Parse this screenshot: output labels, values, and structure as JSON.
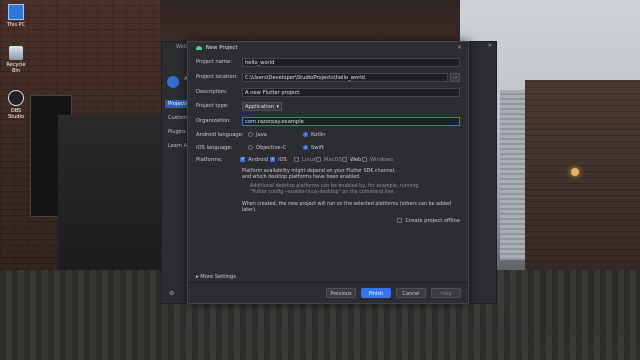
{
  "desktop": {
    "icons": [
      {
        "label": "This PC",
        "icon": "computer-icon"
      },
      {
        "label": "Recycle Bin",
        "icon": "recycle-bin-icon"
      },
      {
        "label": "OBS Studio",
        "icon": "obs-icon"
      }
    ]
  },
  "ide": {
    "title": "Welco",
    "side_label_1": "An",
    "menu": [
      {
        "label": "Projects",
        "active": true
      },
      {
        "label": "Customiz"
      },
      {
        "label": "Plugins"
      },
      {
        "label": "Learn An"
      }
    ]
  },
  "dialog": {
    "title": "New Project",
    "fields": {
      "project_name": {
        "label": "Project name:",
        "value": "hello_world"
      },
      "project_location": {
        "label": "Project location:",
        "value": "C:\\Users\\Developer\\StudioProjects\\hello_world",
        "browse": "..."
      },
      "description": {
        "label": "Description:",
        "value": "A new Flutter project."
      },
      "project_type": {
        "label": "Project type:",
        "value": "Application"
      },
      "organization": {
        "label": "Organization:",
        "value": "com.razorpay.example"
      }
    },
    "android_language": {
      "label": "Android language:",
      "options": [
        "Java",
        "Kotlin"
      ],
      "selected": "Kotlin"
    },
    "ios_language": {
      "label": "iOS language:",
      "options": [
        "Objective-C",
        "Swift"
      ],
      "selected": "Swift"
    },
    "platforms": {
      "label": "Platforms:",
      "items": [
        {
          "label": "Android",
          "checked": true,
          "enabled": true
        },
        {
          "label": "iOS",
          "checked": true,
          "enabled": true
        },
        {
          "label": "Linux",
          "checked": false,
          "enabled": false
        },
        {
          "label": "MacOS",
          "checked": false,
          "enabled": false
        },
        {
          "label": "Web",
          "checked": false,
          "enabled": true
        },
        {
          "label": "Windows",
          "checked": false,
          "enabled": false
        }
      ]
    },
    "notes": {
      "availability_1": "Platform availability might depend on your Flutter SDK channel,",
      "availability_2": "and which desktop platforms have been enabled.",
      "desktop_1": "Additional desktop platforms can be enabled by, for example, running",
      "desktop_2": "\"flutter config --enable-linux-desktop\" on the command line.",
      "created": "When created, the new project will run on the selected platforms (others can be added later)."
    },
    "create_offline": {
      "label": "Create project offline",
      "checked": false
    },
    "more_settings": "More Settings",
    "buttons": {
      "previous": "Previous",
      "finish": "Finish",
      "cancel": "Cancel",
      "help": "Help"
    }
  }
}
